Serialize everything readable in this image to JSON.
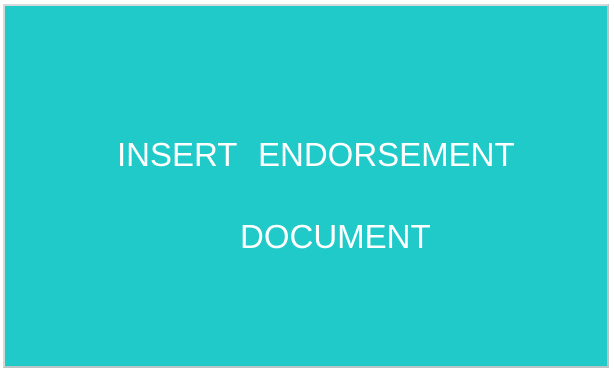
{
  "screen": {
    "background_color": "#1fcac9",
    "text_color": "#ffffff",
    "prompt_line_1": "INSERT ENDORSEMENT",
    "prompt_line_2": "DOCUMENT"
  }
}
